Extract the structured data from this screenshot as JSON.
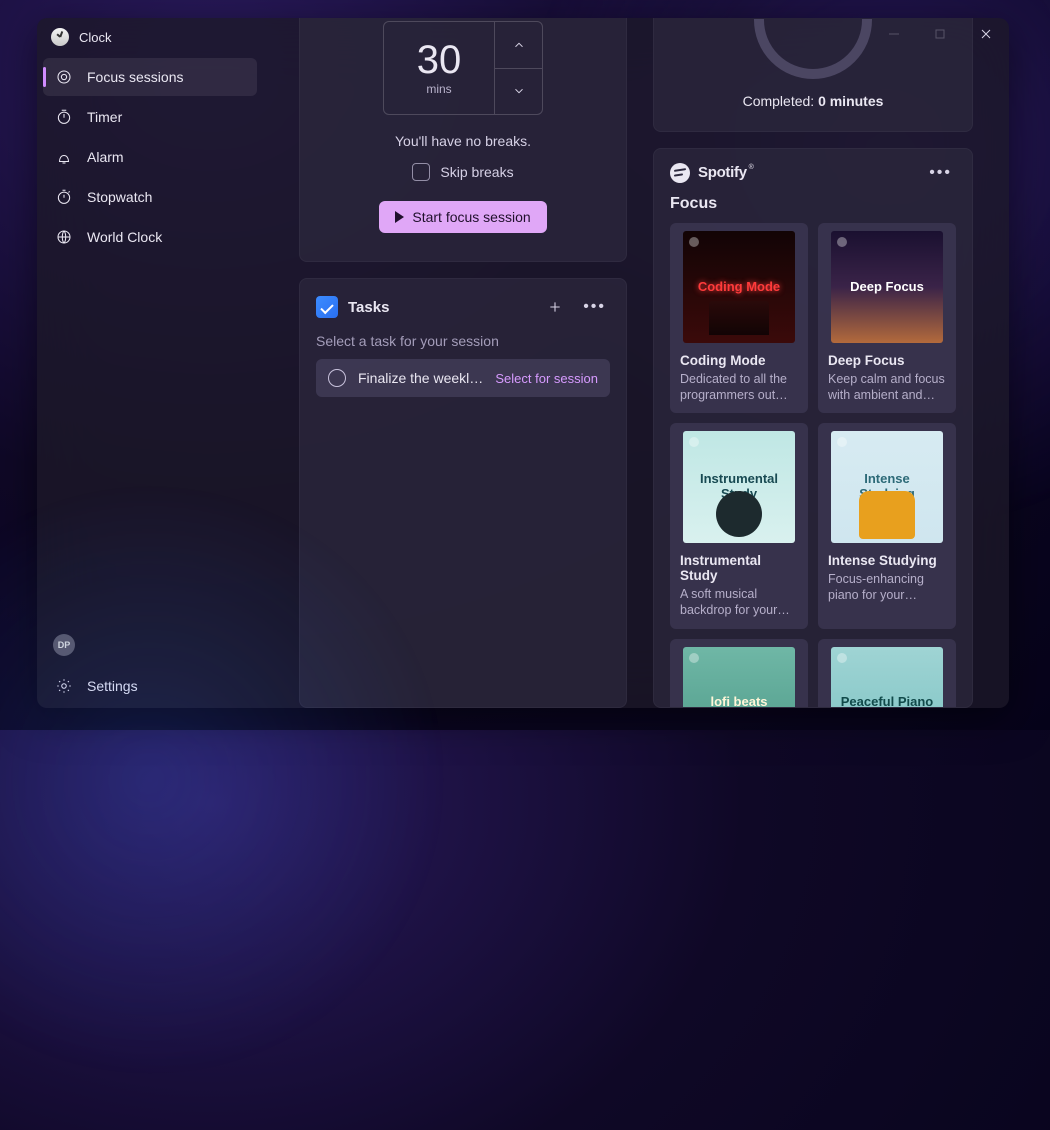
{
  "app": {
    "title": "Clock"
  },
  "sidebar": {
    "items": [
      {
        "label": "Focus sessions"
      },
      {
        "label": "Timer"
      },
      {
        "label": "Alarm"
      },
      {
        "label": "Stopwatch"
      },
      {
        "label": "World Clock"
      }
    ],
    "user_initials": "DP",
    "settings_label": "Settings"
  },
  "focus": {
    "duration_value": "30",
    "duration_unit": "mins",
    "breaks_text": "You'll have no breaks.",
    "skip_label": "Skip breaks",
    "start_label": "Start focus session"
  },
  "progress": {
    "completed_prefix": "Completed: ",
    "completed_value": "0 minutes"
  },
  "tasks": {
    "title": "Tasks",
    "subtitle": "Select a task for your session",
    "items": [
      {
        "name": "Finalize the weekly r…",
        "action": "Select for session"
      }
    ]
  },
  "spotify": {
    "brand": "Spotify",
    "trademark": "®",
    "category": "Focus",
    "playlists": [
      {
        "name": "Coding Mode",
        "art_text": "Coding Mode",
        "desc": "Dedicated to all the programmers out…",
        "art": "art-coding"
      },
      {
        "name": "Deep Focus",
        "art_text": "Deep Focus",
        "desc": "Keep calm and focus with ambient and…",
        "art": "art-deep"
      },
      {
        "name": "Instrumental Study",
        "art_text": "Instrumental Study",
        "desc": "A soft musical backdrop for your…",
        "art": "art-instrum"
      },
      {
        "name": "Intense Studying",
        "art_text": "Intense Studying",
        "desc": "Focus-enhancing piano for your study…",
        "art": "art-intense"
      },
      {
        "name": "lofi beats",
        "art_text": "lofi beats",
        "desc": "",
        "art": "art-lofi"
      },
      {
        "name": "Peaceful Piano",
        "art_text": "Peaceful Piano",
        "desc": "",
        "art": "art-peace"
      }
    ]
  }
}
